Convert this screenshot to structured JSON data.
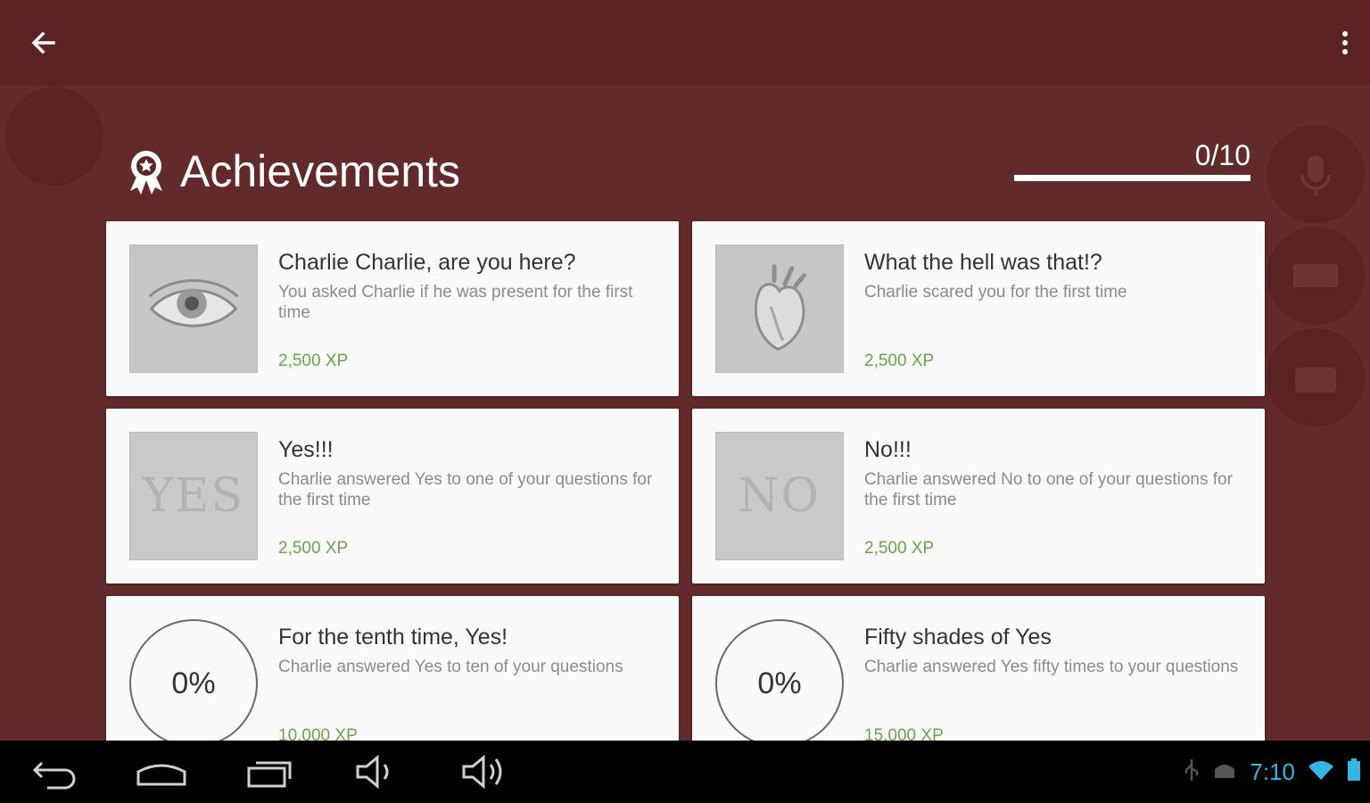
{
  "app_bar": {
    "back_icon": "arrow-back-icon",
    "menu_icon": "overflow-menu-icon"
  },
  "achievements": {
    "title": "Achievements",
    "unlocked": 0,
    "total": 10,
    "progress_label": "0/10",
    "items": [
      {
        "title": "Charlie Charlie, are you here?",
        "description": "You asked Charlie if he was present for the first time",
        "xp": "2,500 XP",
        "icon": "eye-icon"
      },
      {
        "title": "What the hell was that!?",
        "description": "Charlie scared you for the first time",
        "xp": "2,500 XP",
        "icon": "heart-icon"
      },
      {
        "title": "Yes!!!",
        "description": "Charlie answered Yes to one of your questions for the first time",
        "xp": "2,500 XP",
        "icon": "yes-icon",
        "icon_text": "YES"
      },
      {
        "title": "No!!!",
        "description": "Charlie answered No to one of your questions for the first time",
        "xp": "2,500 XP",
        "icon": "no-icon",
        "icon_text": "NO"
      },
      {
        "title": "For the tenth time, Yes!",
        "description": "Charlie answered Yes to ten of your questions",
        "xp": "10,000 XP",
        "progress": "0%"
      },
      {
        "title": "Fifty shades of Yes",
        "description": "Charlie answered Yes fifty times to your questions",
        "xp": "15,000 XP",
        "progress": "0%"
      }
    ]
  },
  "navigation": {
    "buttons": [
      "back-nav-icon",
      "home-nav-icon",
      "recent-apps-icon",
      "volume-down-icon",
      "volume-up-icon"
    ]
  },
  "status_bar": {
    "time": "7:10",
    "icons": [
      "usb-icon",
      "android-debug-icon",
      "wifi-icon",
      "battery-icon"
    ]
  },
  "colors": {
    "app_bar": "#5b2123",
    "overlay_bg": "#622a2b",
    "xp_green": "#6aa44a",
    "clock_blue": "#33b5e5"
  }
}
